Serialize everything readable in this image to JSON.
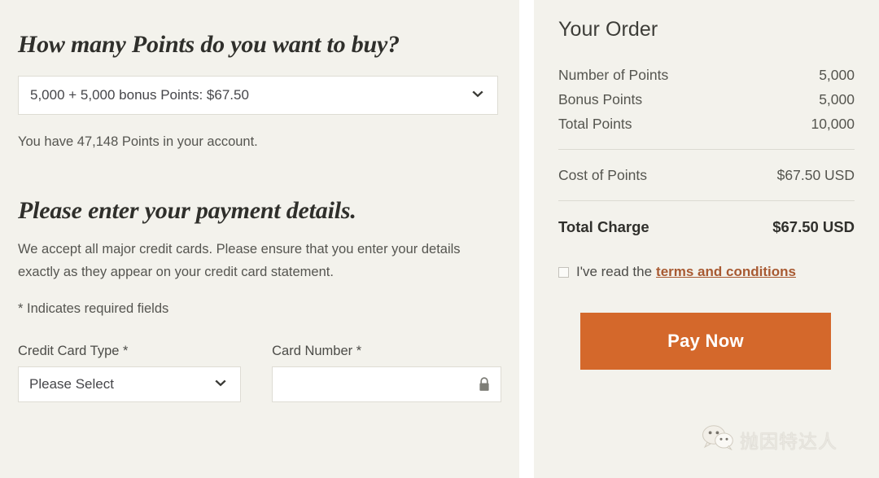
{
  "left": {
    "points_heading": "How many Points do you want to buy?",
    "points_select": {
      "value": "5,000 + 5,000 bonus Points: $67.50",
      "icon": "chevron-down-icon"
    },
    "account_balance_text": "You have 47,148 Points in your account.",
    "payment_heading": "Please enter your payment details.",
    "payment_copy": "We accept all major credit cards. Please ensure that you enter your details exactly as they appear on your credit card statement.",
    "required_note": "* Indicates required fields",
    "fields": {
      "card_type_label": "Credit Card Type *",
      "card_type_value": "Please Select",
      "card_type_icon": "chevron-down-icon",
      "card_number_label": "Card Number *",
      "card_number_value": "",
      "card_number_placeholder": "",
      "card_number_icon": "lock-icon"
    }
  },
  "order": {
    "title": "Your Order",
    "rows": [
      {
        "label": "Number of Points",
        "value": "5,000"
      },
      {
        "label": "Bonus Points",
        "value": "5,000"
      },
      {
        "label": "Total Points",
        "value": "10,000"
      }
    ],
    "cost_row": {
      "label": "Cost of Points",
      "value": "$67.50 USD"
    },
    "total_row": {
      "label": "Total Charge",
      "value": "$67.50 USD"
    },
    "terms": {
      "checked": false,
      "prefix": "I've read the",
      "link_text": "terms and conditions",
      "link_color": "#a85a32"
    },
    "pay_button": {
      "label": "Pay Now",
      "color": "#d4682b"
    }
  },
  "watermark": {
    "icon": "wechat-icon",
    "text": "抛因特达人"
  },
  "theme": {
    "panel_background": "#f3f2ec",
    "gutter": "#ffffff",
    "accent": "#d4682b",
    "link": "#a85a32",
    "text": "#55554f",
    "heading": "#2f2f2b",
    "border": "#dedcd4"
  }
}
